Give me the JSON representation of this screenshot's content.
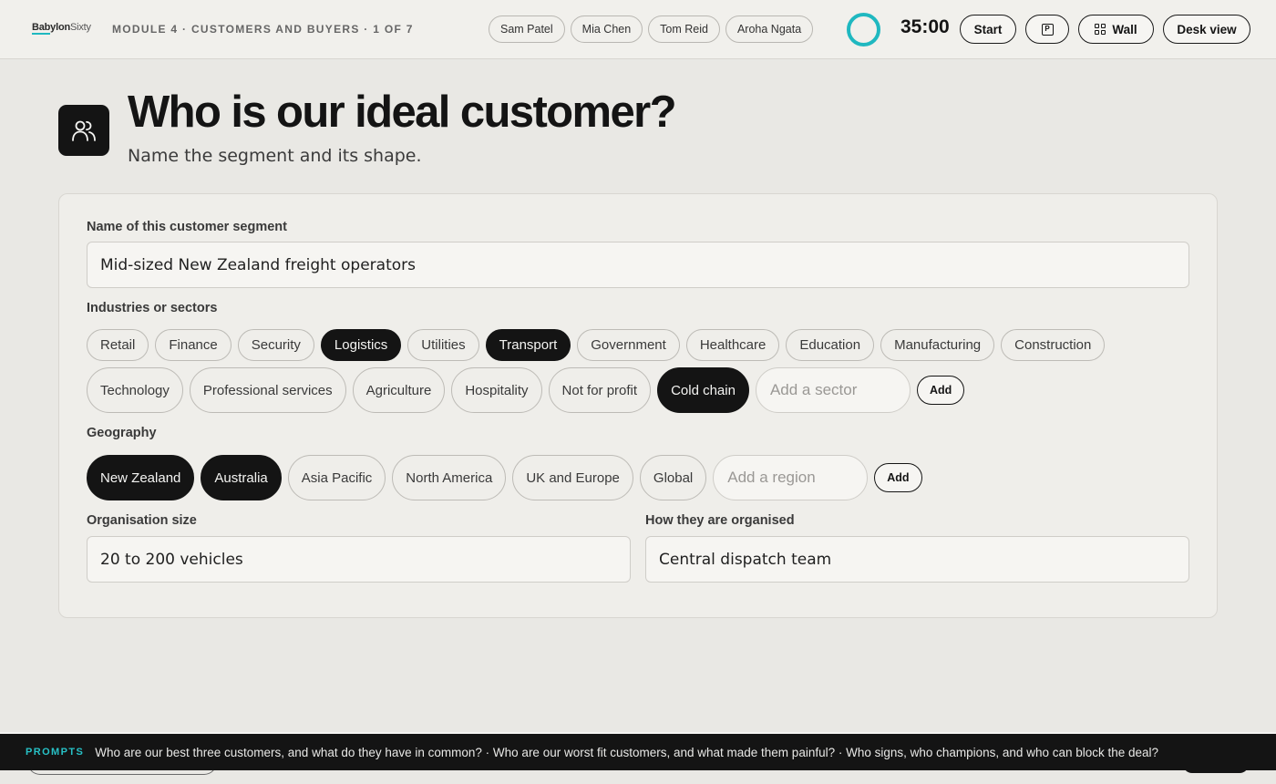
{
  "header": {
    "logo_bold": "Babylon",
    "logo_light": "Sixty",
    "module": "MODULE 4 · CUSTOMERS AND BUYERS · 1 OF 7",
    "participants": [
      "Sam Patel",
      "Mia Chen",
      "Tom Reid",
      "Aroha Ngata"
    ],
    "timer": "35:00",
    "start_label": "Start",
    "parking_icon_label": "P",
    "wall_label": "Wall",
    "desk_view_label": "Desk view",
    "accent_color": "#1fb8c0"
  },
  "page": {
    "icon": "people-icon",
    "title": "Who is our ideal customer?",
    "subtitle": "Name the segment and its shape."
  },
  "form": {
    "segment": {
      "label": "Name of this customer segment",
      "value": "Mid-sized New Zealand freight operators"
    },
    "industries": {
      "label": "Industries or sectors",
      "row1": [
        {
          "label": "Retail",
          "selected": false
        },
        {
          "label": "Finance",
          "selected": false
        },
        {
          "label": "Security",
          "selected": false
        },
        {
          "label": "Logistics",
          "selected": true
        },
        {
          "label": "Utilities",
          "selected": false
        },
        {
          "label": "Transport",
          "selected": true
        },
        {
          "label": "Government",
          "selected": false
        },
        {
          "label": "Healthcare",
          "selected": false
        },
        {
          "label": "Education",
          "selected": false
        },
        {
          "label": "Manufacturing",
          "selected": false
        },
        {
          "label": "Construction",
          "selected": false
        }
      ],
      "row2": [
        {
          "label": "Technology",
          "selected": false
        },
        {
          "label": "Professional services",
          "selected": false
        },
        {
          "label": "Agriculture",
          "selected": false
        },
        {
          "label": "Hospitality",
          "selected": false
        },
        {
          "label": "Not for profit",
          "selected": false
        },
        {
          "label": "Cold chain",
          "selected": true
        }
      ],
      "add_placeholder": "Add a sector",
      "add_label": "Add"
    },
    "geography": {
      "label": "Geography",
      "options": [
        {
          "label": "New Zealand",
          "selected": true
        },
        {
          "label": "Australia",
          "selected": true
        },
        {
          "label": "Asia Pacific",
          "selected": false
        },
        {
          "label": "North America",
          "selected": false
        },
        {
          "label": "UK and Europe",
          "selected": false
        },
        {
          "label": "Global",
          "selected": false
        }
      ],
      "add_placeholder": "Add a region",
      "add_label": "Add"
    },
    "org_size": {
      "label": "Organisation size",
      "value": "20 to 200 vehicles"
    },
    "organised": {
      "label": "How they are organised",
      "value": "Central dispatch team"
    }
  },
  "prompts": {
    "label": "PROMPTS",
    "text": "Who are our best three customers, and what do they have in common? · Who are our worst fit customers, and what made them painful? · Who signs, who champions, and who can block the deal?"
  }
}
